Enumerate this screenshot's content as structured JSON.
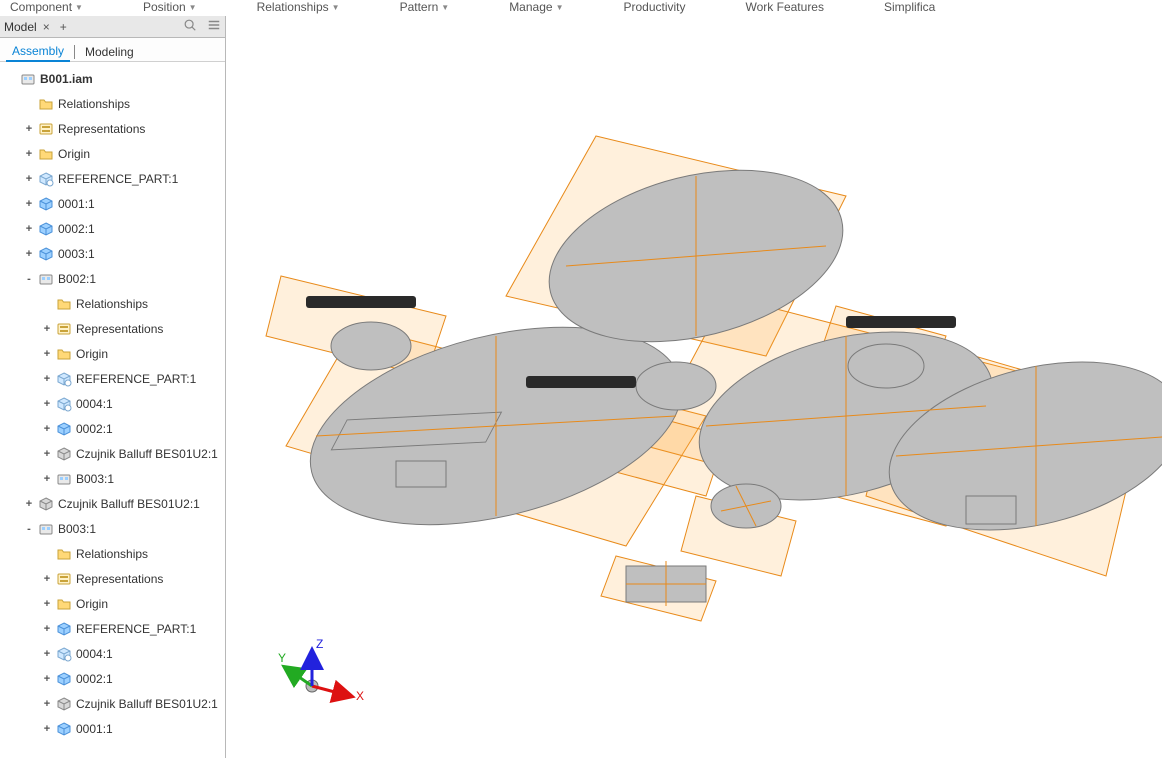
{
  "ribbon": {
    "items": [
      "Component",
      "Position",
      "Relationships",
      "Pattern",
      "Manage",
      "Productivity",
      "Work Features",
      "Simplifica"
    ]
  },
  "panel": {
    "title": "Model",
    "subtabs": {
      "assembly": "Assembly",
      "modeling": "Modeling"
    }
  },
  "triad": {
    "x": "X",
    "y": "Y",
    "z": "Z"
  },
  "tree": [
    {
      "depth": 0,
      "exp": "",
      "icon": "asm",
      "bold": true,
      "label": "B001.iam"
    },
    {
      "depth": 1,
      "exp": "",
      "icon": "folder",
      "label": "Relationships"
    },
    {
      "depth": 1,
      "exp": "+",
      "icon": "rep",
      "label": "Representations"
    },
    {
      "depth": 1,
      "exp": "+",
      "icon": "folder",
      "label": "Origin"
    },
    {
      "depth": 1,
      "exp": "+",
      "icon": "partg",
      "label": "REFERENCE_PART:1"
    },
    {
      "depth": 1,
      "exp": "+",
      "icon": "part",
      "label": "0001:1"
    },
    {
      "depth": 1,
      "exp": "+",
      "icon": "part",
      "label": "0002:1"
    },
    {
      "depth": 1,
      "exp": "+",
      "icon": "part",
      "label": "0003:1"
    },
    {
      "depth": 1,
      "exp": "-",
      "icon": "asm",
      "label": "B002:1"
    },
    {
      "depth": 2,
      "exp": "",
      "icon": "folder",
      "label": "Relationships"
    },
    {
      "depth": 2,
      "exp": "+",
      "icon": "rep",
      "label": "Representations"
    },
    {
      "depth": 2,
      "exp": "+",
      "icon": "folder",
      "label": "Origin"
    },
    {
      "depth": 2,
      "exp": "+",
      "icon": "partg",
      "label": "REFERENCE_PART:1"
    },
    {
      "depth": 2,
      "exp": "+",
      "icon": "partg",
      "label": "0004:1"
    },
    {
      "depth": 2,
      "exp": "+",
      "icon": "part",
      "label": "0002:1"
    },
    {
      "depth": 2,
      "exp": "+",
      "icon": "comp",
      "label": "Czujnik Balluff BES01U2:1"
    },
    {
      "depth": 2,
      "exp": "+",
      "icon": "asm",
      "label": "B003:1"
    },
    {
      "depth": 1,
      "exp": "+",
      "icon": "comp",
      "label": "Czujnik Balluff BES01U2:1"
    },
    {
      "depth": 1,
      "exp": "-",
      "icon": "asm",
      "label": "B003:1"
    },
    {
      "depth": 2,
      "exp": "",
      "icon": "folder",
      "label": "Relationships"
    },
    {
      "depth": 2,
      "exp": "+",
      "icon": "rep",
      "label": "Representations"
    },
    {
      "depth": 2,
      "exp": "+",
      "icon": "folder",
      "label": "Origin"
    },
    {
      "depth": 2,
      "exp": "+",
      "icon": "part",
      "label": "REFERENCE_PART:1"
    },
    {
      "depth": 2,
      "exp": "+",
      "icon": "partg",
      "label": "0004:1"
    },
    {
      "depth": 2,
      "exp": "+",
      "icon": "part",
      "label": "0002:1"
    },
    {
      "depth": 2,
      "exp": "+",
      "icon": "comp",
      "label": "Czujnik Balluff BES01U2:1"
    },
    {
      "depth": 2,
      "exp": "+",
      "icon": "part",
      "label": "0001:1"
    }
  ]
}
